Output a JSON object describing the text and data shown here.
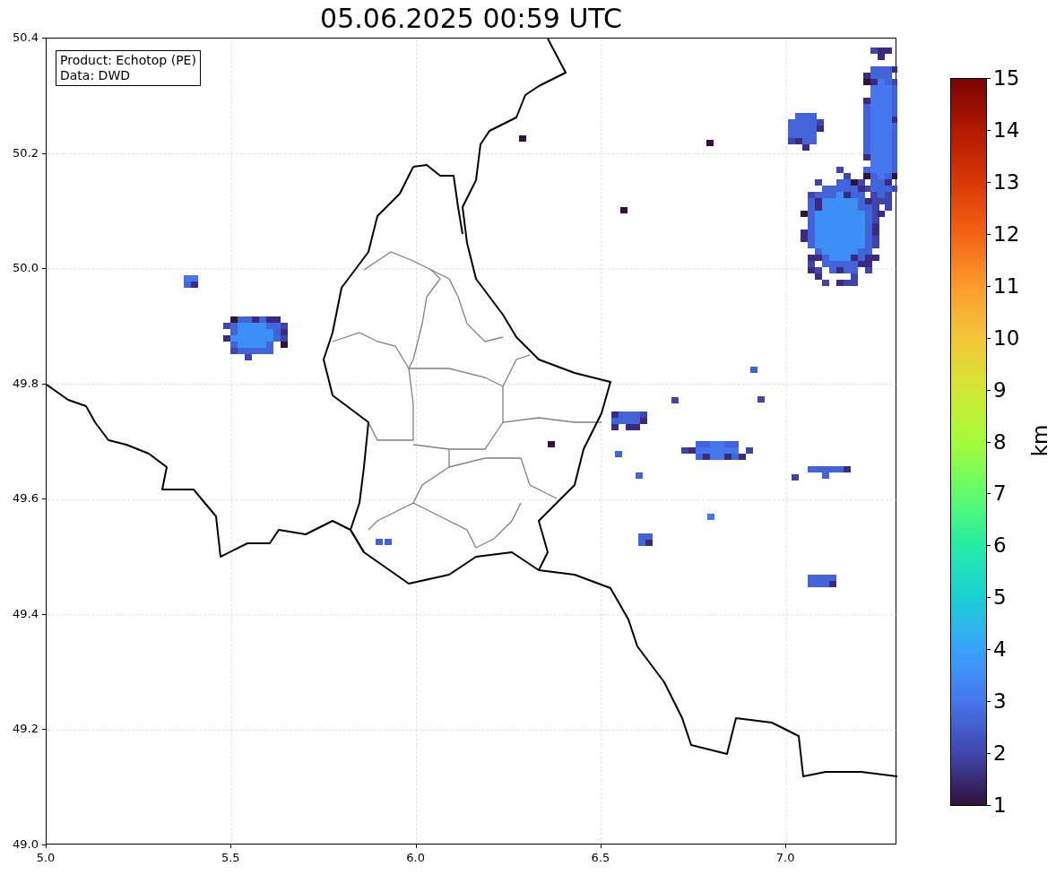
{
  "title": "05.06.2025 00:59 UTC",
  "info_box": [
    "Product: Echotop (PE)",
    "Data: DWD"
  ],
  "y_ticks": [
    "50.4",
    "50.2",
    "50.0",
    "49.8",
    "49.6",
    "49.4",
    "49.2",
    "49.0"
  ],
  "x_ticks": [
    "5.0",
    "5.5",
    "6.0",
    "6.5",
    "7.0"
  ],
  "colorbar": {
    "ticks": [
      "15",
      "14",
      "13",
      "12",
      "11",
      "10",
      "9",
      "8",
      "7",
      "6",
      "5",
      "4",
      "3",
      "2",
      "1"
    ],
    "label": "km"
  }
}
